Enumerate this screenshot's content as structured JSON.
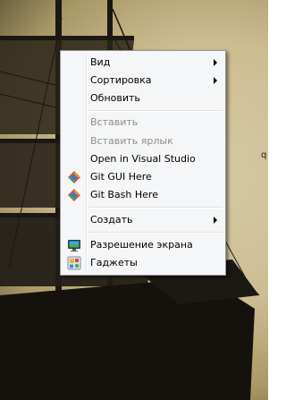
{
  "desktop": {
    "partial_label": "q"
  },
  "context_menu": {
    "groups": [
      {
        "items": [
          {
            "label": "Вид",
            "submenu": true,
            "enabled": true
          },
          {
            "label": "Сортировка",
            "submenu": true,
            "enabled": true
          },
          {
            "label": "Обновить",
            "submenu": false,
            "enabled": true
          }
        ]
      },
      {
        "items": [
          {
            "label": "Вставить",
            "enabled": false
          },
          {
            "label": "Вставить ярлык",
            "enabled": false
          },
          {
            "label": "Open in Visual Studio",
            "enabled": true
          },
          {
            "label": "Git GUI Here",
            "enabled": true,
            "icon": "git-icon"
          },
          {
            "label": "Git Bash Here",
            "enabled": true,
            "icon": "git-icon"
          }
        ]
      },
      {
        "items": [
          {
            "label": "Создать",
            "submenu": true,
            "enabled": true
          }
        ]
      },
      {
        "items": [
          {
            "label": "Разрешение экрана",
            "enabled": true,
            "icon": "monitor-icon"
          },
          {
            "label": "Гаджеты",
            "enabled": true,
            "icon": "gadgets-icon"
          }
        ]
      }
    ]
  },
  "colors": {
    "menu_background": "#f5f6f7",
    "menu_border": "#979797",
    "disabled_text": "#8d8d8d"
  }
}
